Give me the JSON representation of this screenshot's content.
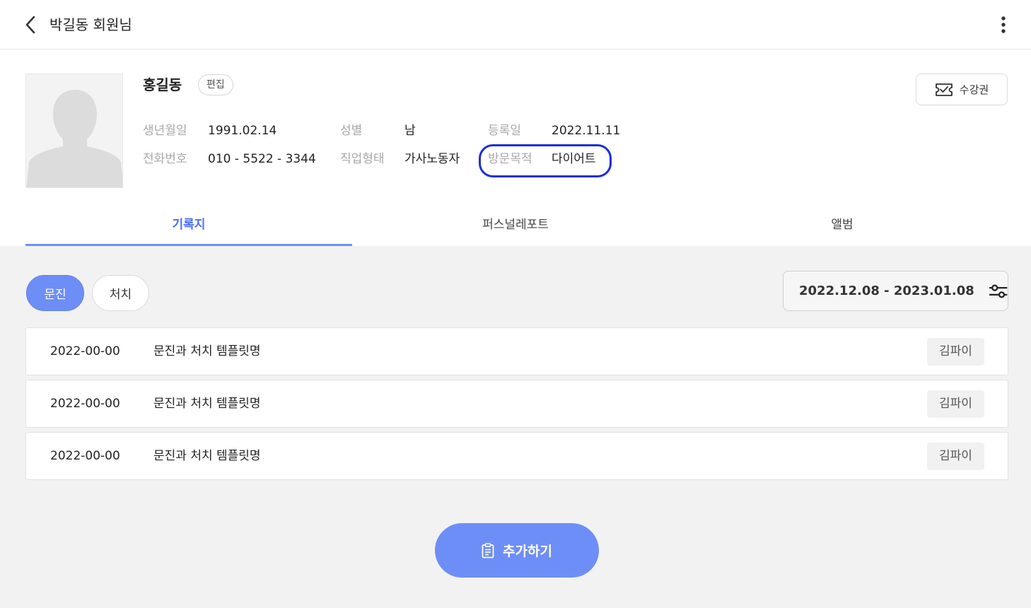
{
  "header": {
    "title": "박길동 회원님"
  },
  "profile": {
    "name": "홍길동",
    "edit_label": "편집",
    "ticket_label": "수강권",
    "fields": {
      "birth": {
        "label": "생년월일",
        "value": "1991.02.14"
      },
      "phone": {
        "label": "전화번호",
        "value": "010 - 5522 - 3344"
      },
      "gender": {
        "label": "성별",
        "value": "남"
      },
      "job": {
        "label": "직업형태",
        "value": "가사노동자"
      },
      "registered": {
        "label": "등록일",
        "value": "2022.11.11"
      },
      "purpose": {
        "label": "방문목적",
        "value": "다이어트"
      }
    }
  },
  "tabs": [
    {
      "label": "기록지",
      "active": true
    },
    {
      "label": "퍼스널레포트",
      "active": false
    },
    {
      "label": "앨범",
      "active": false
    }
  ],
  "filters": {
    "exam_label": "문진",
    "treatment_label": "처치",
    "date_range": "2022.12.08 - 2023.01.08"
  },
  "records": [
    {
      "date": "2022-00-00",
      "title": "문진과 처치 템플릿명",
      "author": "김파이"
    },
    {
      "date": "2022-00-00",
      "title": "문진과 처치 템플릿명",
      "author": "김파이"
    },
    {
      "date": "2022-00-00",
      "title": "문진과 처치 템플릿명",
      "author": "김파이"
    }
  ],
  "add_button_label": "추가하기",
  "colors": {
    "accent": "#6e8ef7",
    "tab_active": "#4a70f0",
    "highlight_border": "#1a2fdc"
  },
  "icons": {
    "back": "chevron-left-icon",
    "more": "more-vertical-icon",
    "ticket": "ticket-icon",
    "filter": "sliders-icon",
    "add": "clipboard-icon"
  }
}
